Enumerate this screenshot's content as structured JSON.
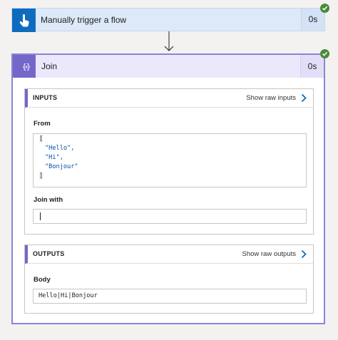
{
  "trigger": {
    "title": "Manually trigger a flow",
    "duration": "0s",
    "status": "succeeded",
    "icon": "touch-hand-icon",
    "accent": "#0f6cbd"
  },
  "action": {
    "title": "Join",
    "duration": "0s",
    "status": "succeeded",
    "icon": "curly-braces-icon",
    "accent": "#7467c9",
    "inputs": {
      "header": "INPUTS",
      "link": "Show raw inputs",
      "from_label": "From",
      "from_open": "[",
      "from_items": [
        "\"Hello\",",
        "\"Hi\",",
        "\"Bonjour\""
      ],
      "from_close": "]",
      "join_label": "Join with",
      "join_value": ""
    },
    "outputs": {
      "header": "OUTPUTS",
      "link": "Show raw outputs",
      "body_label": "Body",
      "body_value": "Hello|Hi|Bonjour"
    }
  },
  "colors": {
    "success": "#4b8a3d",
    "link_chevron": "#0f6cbd"
  }
}
